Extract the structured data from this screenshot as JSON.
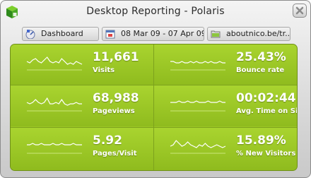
{
  "window": {
    "title": "Desktop Reporting - Polaris"
  },
  "toolbar": {
    "dashboard_label": "Dashboard",
    "date_range": "08 Mar 09 - 07 Apr 09",
    "site_path": "aboutnico.be/tr..."
  },
  "metrics": [
    {
      "value": "11,661",
      "label": "Visits",
      "spark": [
        6,
        5,
        7,
        8,
        6,
        5,
        7,
        9,
        6,
        5,
        6,
        5,
        8,
        6,
        4,
        5,
        4,
        6,
        5,
        4
      ]
    },
    {
      "value": "25.43%",
      "label": "Bounce rate",
      "spark": [
        6,
        6,
        5,
        5,
        6,
        5,
        5,
        6,
        5,
        6,
        5,
        5,
        6,
        5,
        6,
        5,
        5,
        6,
        5,
        5
      ]
    },
    {
      "value": "68,988",
      "label": "Pageviews",
      "spark": [
        6,
        5,
        6,
        8,
        6,
        5,
        6,
        9,
        5,
        5,
        6,
        5,
        8,
        5,
        4,
        5,
        5,
        6,
        5,
        5
      ]
    },
    {
      "value": "00:02:44",
      "label": "Avg. Time on Site",
      "spark": [
        6,
        6,
        6,
        7,
        6,
        6,
        7,
        6,
        6,
        7,
        6,
        6,
        6,
        7,
        6,
        6,
        6,
        7,
        6,
        6
      ]
    },
    {
      "value": "5.92",
      "label": "Pages/Visit",
      "spark": [
        6,
        6,
        7,
        6,
        6,
        7,
        6,
        6,
        6,
        7,
        6,
        6,
        7,
        6,
        6,
        6,
        7,
        6,
        6,
        6
      ]
    },
    {
      "value": "15.89%",
      "label": "% New Visitors",
      "spark": [
        5,
        6,
        9,
        7,
        5,
        6,
        8,
        6,
        5,
        4,
        6,
        5,
        7,
        5,
        4,
        5,
        6,
        5,
        4,
        5
      ]
    }
  ],
  "colors": {
    "panel": "#9cc726",
    "spark": "#ffffff"
  }
}
